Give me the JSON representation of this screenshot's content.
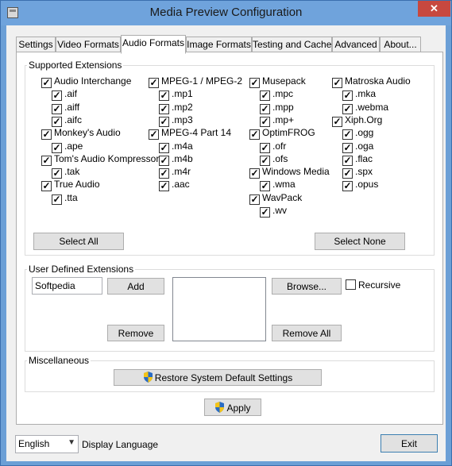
{
  "window": {
    "title": "Media Preview Configuration",
    "close_glyph": "✕"
  },
  "tabs": [
    "Settings",
    "Video Formats",
    "Audio Formats",
    "Image Formats",
    "Testing and Cache",
    "Advanced",
    "About..."
  ],
  "active_tab": "Audio Formats",
  "supported_extensions": {
    "title": "Supported Extensions",
    "check_glyph": "✓",
    "columns": [
      [
        {
          "label": "Audio Interchange",
          "indent": 0
        },
        {
          "label": ".aif",
          "indent": 1
        },
        {
          "label": ".aiff",
          "indent": 1
        },
        {
          "label": ".aifc",
          "indent": 1
        },
        {
          "label": "Monkey's Audio",
          "indent": 0
        },
        {
          "label": ".ape",
          "indent": 1
        },
        {
          "label": "Tom's Audio Kompressor",
          "indent": 0
        },
        {
          "label": ".tak",
          "indent": 1
        },
        {
          "label": "True Audio",
          "indent": 0
        },
        {
          "label": ".tta",
          "indent": 1
        }
      ],
      [
        {
          "label": "MPEG-1 / MPEG-2",
          "indent": 0
        },
        {
          "label": ".mp1",
          "indent": 1
        },
        {
          "label": ".mp2",
          "indent": 1
        },
        {
          "label": ".mp3",
          "indent": 1
        },
        {
          "label": "MPEG-4 Part 14",
          "indent": 0
        },
        {
          "label": ".m4a",
          "indent": 1
        },
        {
          "label": ".m4b",
          "indent": 1
        },
        {
          "label": ".m4r",
          "indent": 1
        },
        {
          "label": ".aac",
          "indent": 1
        }
      ],
      [
        {
          "label": "Musepack",
          "indent": 0
        },
        {
          "label": ".mpc",
          "indent": 1
        },
        {
          "label": ".mpp",
          "indent": 1
        },
        {
          "label": ".mp+",
          "indent": 1
        },
        {
          "label": "OptimFROG",
          "indent": 0
        },
        {
          "label": ".ofr",
          "indent": 1
        },
        {
          "label": ".ofs",
          "indent": 1
        },
        {
          "label": "Windows Media",
          "indent": 0
        },
        {
          "label": ".wma",
          "indent": 1
        },
        {
          "label": "WavPack",
          "indent": 0
        },
        {
          "label": ".wv",
          "indent": 1
        }
      ],
      [
        {
          "label": "Matroska Audio",
          "indent": 0
        },
        {
          "label": ".mka",
          "indent": 1
        },
        {
          "label": ".webma",
          "indent": 1
        },
        {
          "label": "Xiph.Org",
          "indent": 0
        },
        {
          "label": ".ogg",
          "indent": 1
        },
        {
          "label": ".oga",
          "indent": 1
        },
        {
          "label": ".flac",
          "indent": 1
        },
        {
          "label": ".spx",
          "indent": 1
        },
        {
          "label": ".opus",
          "indent": 1
        }
      ]
    ],
    "select_all_label": "Select All",
    "select_none_label": "Select None"
  },
  "user_defined": {
    "title": "User Defined Extensions",
    "input_value": "Softpedia",
    "add_label": "Add",
    "remove_label": "Remove",
    "browse_label": "Browse...",
    "recursive_label": "Recursive",
    "remove_all_label": "Remove All"
  },
  "misc": {
    "title": "Miscellaneous",
    "restore_label": "Restore System Default Settings"
  },
  "apply_label": "Apply",
  "language": {
    "selected": "English",
    "label": "Display Language"
  },
  "exit_label": "Exit",
  "colors": {
    "titlebar": "#6fa3dc",
    "close": "#c7483f",
    "panel": "#ffffff",
    "dialog": "#f0f0f0"
  }
}
